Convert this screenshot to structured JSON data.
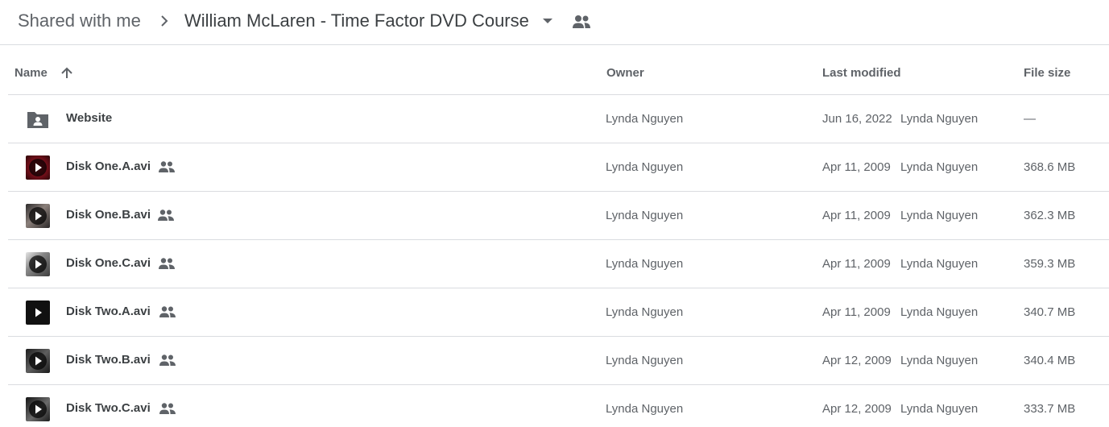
{
  "breadcrumb": {
    "root": "Shared with me",
    "current": "William McLaren - Time Factor DVD Course"
  },
  "columns": {
    "name": "Name",
    "owner": "Owner",
    "modified": "Last modified",
    "size": "File size"
  },
  "files": [
    {
      "name": "Website",
      "owner": "Lynda Nguyen",
      "date": "Jun 16, 2022",
      "by": "Lynda Nguyen",
      "size": "—",
      "type": "shared-folder"
    },
    {
      "name": "Disk One.A.avi",
      "owner": "Lynda Nguyen",
      "date": "Apr 11, 2009",
      "by": "Lynda Nguyen",
      "size": "368.6 MB",
      "type": "video"
    },
    {
      "name": "Disk One.B.avi",
      "owner": "Lynda Nguyen",
      "date": "Apr 11, 2009",
      "by": "Lynda Nguyen",
      "size": "362.3 MB",
      "type": "video"
    },
    {
      "name": "Disk One.C.avi",
      "owner": "Lynda Nguyen",
      "date": "Apr 11, 2009",
      "by": "Lynda Nguyen",
      "size": "359.3 MB",
      "type": "video"
    },
    {
      "name": "Disk Two.A.avi",
      "owner": "Lynda Nguyen",
      "date": "Apr 11, 2009",
      "by": "Lynda Nguyen",
      "size": "340.7 MB",
      "type": "video"
    },
    {
      "name": "Disk Two.B.avi",
      "owner": "Lynda Nguyen",
      "date": "Apr 12, 2009",
      "by": "Lynda Nguyen",
      "size": "340.4 MB",
      "type": "video"
    },
    {
      "name": "Disk Two.C.avi",
      "owner": "Lynda Nguyen",
      "date": "Apr 12, 2009",
      "by": "Lynda Nguyen",
      "size": "333.7 MB",
      "type": "video"
    }
  ],
  "icons": {
    "breadcrumb_separator": "chevron-right-icon",
    "breadcrumb_menu": "caret-down-icon",
    "folder_shared": "people-icon",
    "sort": "arrow-up-icon",
    "folder": "shared-folder-icon",
    "video": "play-icon",
    "file_shared": "people-icon"
  },
  "colors": {
    "text_primary": "#3c4043",
    "text_secondary": "#5f6368",
    "divider": "#dadce0"
  }
}
